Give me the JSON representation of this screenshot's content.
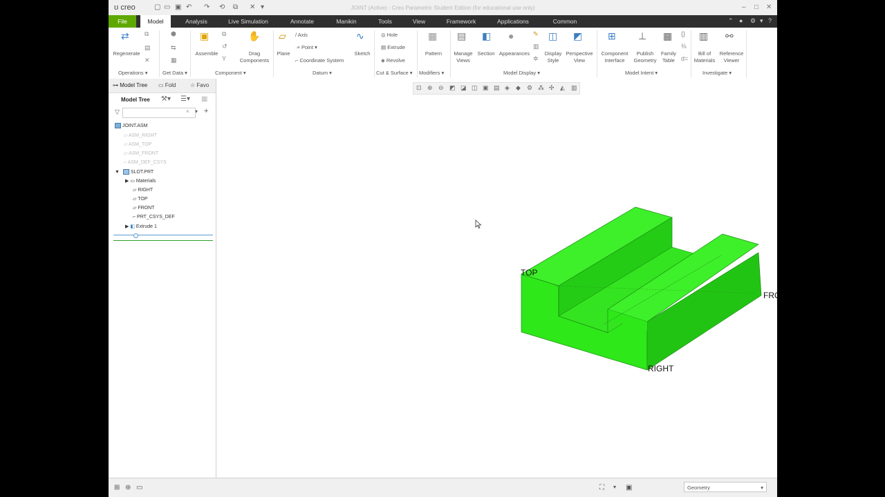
{
  "app": {
    "logo": "creo",
    "title": "JOINT (Active) - Creo Parametric Student Edition (for educational use only)"
  },
  "tabs": [
    "File",
    "Model",
    "Analysis",
    "Live Simulation",
    "Annotate",
    "Manikin",
    "Tools",
    "View",
    "Framework",
    "Applications",
    "Common"
  ],
  "ribbon": {
    "regenerate": "Regenerate",
    "assemble": "Assemble",
    "drag_components": "Drag\nComponents",
    "plane": "Plane",
    "axis": "Axis",
    "point": "Point",
    "coordinate_system": "Coordinate System",
    "sketch": "Sketch",
    "hole": "Hole",
    "extrude": "Extrude",
    "revolve": "Revolve",
    "pattern": "Pattern",
    "manage_views": "Manage\nViews",
    "section": "Section",
    "appearances": "Appearances",
    "display_style": "Display\nStyle",
    "perspective_view": "Perspective\nView",
    "component_interface": "Component\nInterface",
    "publish_geometry": "Publish\nGeometry",
    "family_table": "Family\nTable",
    "bill_of_materials": "Bill of\nMaterials",
    "reference_viewer": "Reference\nViewer",
    "groups": {
      "operations": "Operations",
      "get_data": "Get Data",
      "component": "Component",
      "datum": "Datum",
      "cut_surface": "Cut & Surface",
      "modifiers": "Modifiers",
      "model_display": "Model Display",
      "model_intent": "Model Intent",
      "investigate": "Investigate"
    }
  },
  "panel": {
    "tabs": [
      "Model Tree",
      "Fold",
      "Favo"
    ],
    "header": "Model Tree",
    "tree": [
      {
        "label": "JOINT.ASM",
        "dim": false
      },
      {
        "label": "ASM_RIGHT",
        "dim": true
      },
      {
        "label": "ASM_TOP",
        "dim": true
      },
      {
        "label": "ASM_FRONT",
        "dim": true
      },
      {
        "label": "ASM_DEF_CSYS",
        "dim": true
      },
      {
        "label": "SLOT.PRT",
        "dim": false
      },
      {
        "label": "Materials",
        "dim": false
      },
      {
        "label": "RIGHT",
        "dim": false
      },
      {
        "label": "TOP",
        "dim": false
      },
      {
        "label": "FRONT",
        "dim": false
      },
      {
        "label": "PRT_CSYS_DEF",
        "dim": false
      },
      {
        "label": "Extrude 1",
        "dim": false
      }
    ]
  },
  "model": {
    "color": "#2ee81a",
    "datum_labels": {
      "top": "TOP",
      "front": "FRONT",
      "right": "RIGHT"
    }
  },
  "status": {
    "selection_filter": "Geometry"
  }
}
